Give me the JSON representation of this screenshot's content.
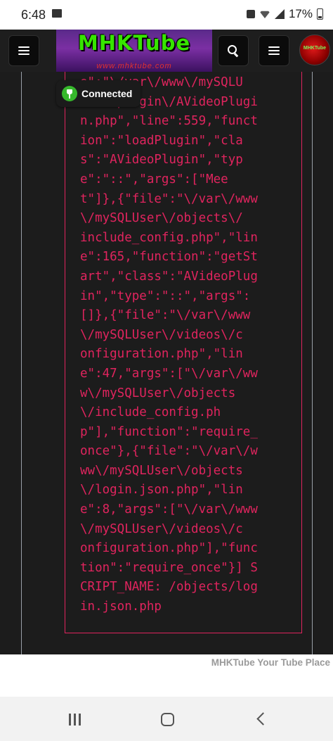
{
  "status_bar": {
    "time": "6:48",
    "battery": "17%"
  },
  "navbar": {
    "logo_text": "MHKTube",
    "logo_url": "www.mhktube.com",
    "avatar_text": "MHKTube"
  },
  "toast": {
    "label": "Connected"
  },
  "error": {
    "lines": [
      "e\":\"\\/var\\/www\\/mySQLU",
      "ser\\/plugin\\/AVideoPlugi",
      "n.php\",\"line\":559,\"funct",
      "ion\":\"loadPlugin\",\"cla",
      "s\":\"AVideoPlugin\",\"typ",
      "e\":\"::\",\"args\":[\"Mee",
      "t\"]},{\"file\":\"\\/var\\/www",
      "\\/mySQLUser\\/objects\\/",
      "include_config.php\",\"lin",
      "e\":165,\"function\":\"getSt",
      "art\",\"class\":\"AVideoPlug",
      "in\",\"type\":\"::\",\"args\":",
      "[]},{\"file\":\"\\/var\\/www",
      "\\/mySQLUser\\/videos\\/c",
      "onfiguration.php\",\"lin",
      "e\":47,\"args\":[\"\\/var\\/ww",
      "w\\/mySQLUser\\/objects",
      "\\/include_config.ph",
      "p\"],\"function\":\"require_",
      "once\"},{\"file\":\"\\/var\\/w",
      "ww\\/mySQLUser\\/objects",
      "\\/login.json.php\",\"lin",
      "e\":8,\"args\":[\"\\/var\\/www",
      "\\/mySQLUser\\/videos\\/c",
      "onfiguration.php\"],\"func",
      "tion\":\"require_once\"}] S",
      "CRIPT_NAME: /objects/log",
      "in.json.php"
    ]
  },
  "footer": {
    "text": "MHKTube Your Tube Place"
  },
  "colors": {
    "error": "#e0245e",
    "toast_accent": "#36b82c"
  }
}
